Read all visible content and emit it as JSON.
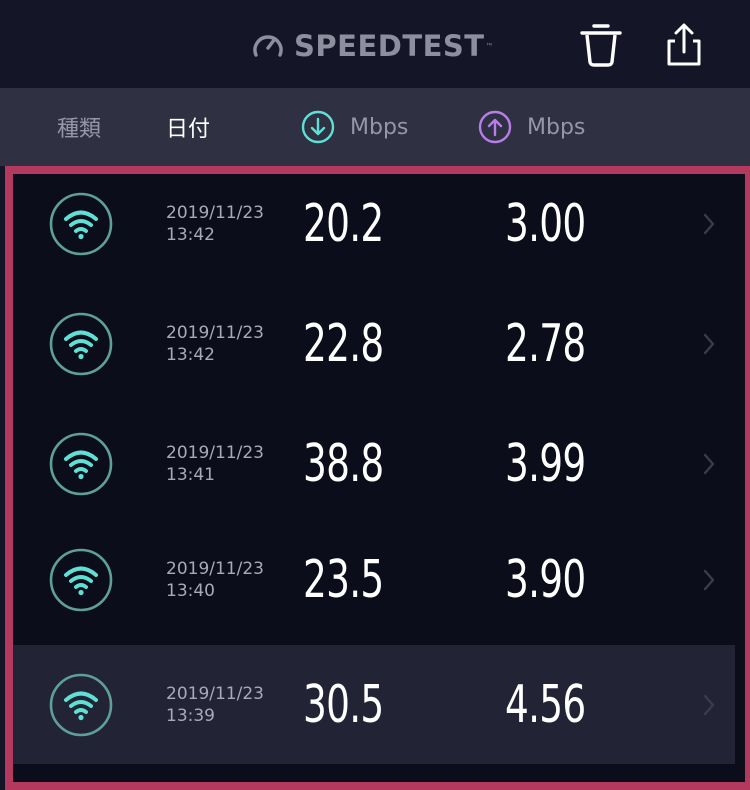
{
  "app": {
    "brand": "SPEEDTEST",
    "brand_mark": "™"
  },
  "toolbar": {
    "delete_icon": "trash-icon",
    "share_icon": "share-icon"
  },
  "columns": {
    "type": "種類",
    "date": "日付",
    "download": "Mbps",
    "upload": "Mbps",
    "download_icon": "arrow-down-circle-icon",
    "upload_icon": "arrow-up-circle-icon"
  },
  "colors": {
    "accent_download": "#5fe0d5",
    "accent_upload": "#b67ee8",
    "highlight_frame": "#b33a5e"
  },
  "results": [
    {
      "connection": "wifi-icon",
      "date": "2019/11/23",
      "time": "13:42",
      "download": "20.2",
      "upload": "3.00",
      "selected": false
    },
    {
      "connection": "wifi-icon",
      "date": "2019/11/23",
      "time": "13:42",
      "download": "22.8",
      "upload": "2.78",
      "selected": false
    },
    {
      "connection": "wifi-icon",
      "date": "2019/11/23",
      "time": "13:41",
      "download": "38.8",
      "upload": "3.99",
      "selected": false
    },
    {
      "connection": "wifi-icon",
      "date": "2019/11/23",
      "time": "13:40",
      "download": "23.5",
      "upload": "3.90",
      "selected": false
    },
    {
      "connection": "wifi-icon",
      "date": "2019/11/23",
      "time": "13:39",
      "download": "30.5",
      "upload": "4.56",
      "selected": true
    }
  ]
}
